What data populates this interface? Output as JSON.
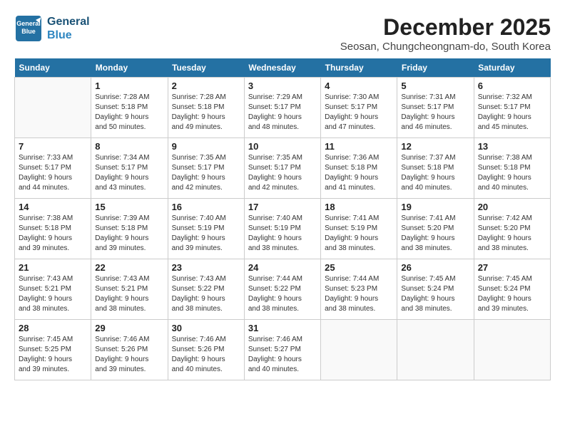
{
  "logo": {
    "line1": "General",
    "line2": "Blue"
  },
  "title": "December 2025",
  "location": "Seosan, Chungcheongnam-do, South Korea",
  "weekdays": [
    "Sunday",
    "Monday",
    "Tuesday",
    "Wednesday",
    "Thursday",
    "Friday",
    "Saturday"
  ],
  "weeks": [
    [
      {
        "day": "",
        "info": ""
      },
      {
        "day": "1",
        "info": "Sunrise: 7:28 AM\nSunset: 5:18 PM\nDaylight: 9 hours\nand 50 minutes."
      },
      {
        "day": "2",
        "info": "Sunrise: 7:28 AM\nSunset: 5:18 PM\nDaylight: 9 hours\nand 49 minutes."
      },
      {
        "day": "3",
        "info": "Sunrise: 7:29 AM\nSunset: 5:17 PM\nDaylight: 9 hours\nand 48 minutes."
      },
      {
        "day": "4",
        "info": "Sunrise: 7:30 AM\nSunset: 5:17 PM\nDaylight: 9 hours\nand 47 minutes."
      },
      {
        "day": "5",
        "info": "Sunrise: 7:31 AM\nSunset: 5:17 PM\nDaylight: 9 hours\nand 46 minutes."
      },
      {
        "day": "6",
        "info": "Sunrise: 7:32 AM\nSunset: 5:17 PM\nDaylight: 9 hours\nand 45 minutes."
      }
    ],
    [
      {
        "day": "7",
        "info": "Sunrise: 7:33 AM\nSunset: 5:17 PM\nDaylight: 9 hours\nand 44 minutes."
      },
      {
        "day": "8",
        "info": "Sunrise: 7:34 AM\nSunset: 5:17 PM\nDaylight: 9 hours\nand 43 minutes."
      },
      {
        "day": "9",
        "info": "Sunrise: 7:35 AM\nSunset: 5:17 PM\nDaylight: 9 hours\nand 42 minutes."
      },
      {
        "day": "10",
        "info": "Sunrise: 7:35 AM\nSunset: 5:17 PM\nDaylight: 9 hours\nand 42 minutes."
      },
      {
        "day": "11",
        "info": "Sunrise: 7:36 AM\nSunset: 5:18 PM\nDaylight: 9 hours\nand 41 minutes."
      },
      {
        "day": "12",
        "info": "Sunrise: 7:37 AM\nSunset: 5:18 PM\nDaylight: 9 hours\nand 40 minutes."
      },
      {
        "day": "13",
        "info": "Sunrise: 7:38 AM\nSunset: 5:18 PM\nDaylight: 9 hours\nand 40 minutes."
      }
    ],
    [
      {
        "day": "14",
        "info": "Sunrise: 7:38 AM\nSunset: 5:18 PM\nDaylight: 9 hours\nand 39 minutes."
      },
      {
        "day": "15",
        "info": "Sunrise: 7:39 AM\nSunset: 5:18 PM\nDaylight: 9 hours\nand 39 minutes."
      },
      {
        "day": "16",
        "info": "Sunrise: 7:40 AM\nSunset: 5:19 PM\nDaylight: 9 hours\nand 39 minutes."
      },
      {
        "day": "17",
        "info": "Sunrise: 7:40 AM\nSunset: 5:19 PM\nDaylight: 9 hours\nand 38 minutes."
      },
      {
        "day": "18",
        "info": "Sunrise: 7:41 AM\nSunset: 5:19 PM\nDaylight: 9 hours\nand 38 minutes."
      },
      {
        "day": "19",
        "info": "Sunrise: 7:41 AM\nSunset: 5:20 PM\nDaylight: 9 hours\nand 38 minutes."
      },
      {
        "day": "20",
        "info": "Sunrise: 7:42 AM\nSunset: 5:20 PM\nDaylight: 9 hours\nand 38 minutes."
      }
    ],
    [
      {
        "day": "21",
        "info": "Sunrise: 7:43 AM\nSunset: 5:21 PM\nDaylight: 9 hours\nand 38 minutes."
      },
      {
        "day": "22",
        "info": "Sunrise: 7:43 AM\nSunset: 5:21 PM\nDaylight: 9 hours\nand 38 minutes."
      },
      {
        "day": "23",
        "info": "Sunrise: 7:43 AM\nSunset: 5:22 PM\nDaylight: 9 hours\nand 38 minutes."
      },
      {
        "day": "24",
        "info": "Sunrise: 7:44 AM\nSunset: 5:22 PM\nDaylight: 9 hours\nand 38 minutes."
      },
      {
        "day": "25",
        "info": "Sunrise: 7:44 AM\nSunset: 5:23 PM\nDaylight: 9 hours\nand 38 minutes."
      },
      {
        "day": "26",
        "info": "Sunrise: 7:45 AM\nSunset: 5:24 PM\nDaylight: 9 hours\nand 38 minutes."
      },
      {
        "day": "27",
        "info": "Sunrise: 7:45 AM\nSunset: 5:24 PM\nDaylight: 9 hours\nand 39 minutes."
      }
    ],
    [
      {
        "day": "28",
        "info": "Sunrise: 7:45 AM\nSunset: 5:25 PM\nDaylight: 9 hours\nand 39 minutes."
      },
      {
        "day": "29",
        "info": "Sunrise: 7:46 AM\nSunset: 5:26 PM\nDaylight: 9 hours\nand 39 minutes."
      },
      {
        "day": "30",
        "info": "Sunrise: 7:46 AM\nSunset: 5:26 PM\nDaylight: 9 hours\nand 40 minutes."
      },
      {
        "day": "31",
        "info": "Sunrise: 7:46 AM\nSunset: 5:27 PM\nDaylight: 9 hours\nand 40 minutes."
      },
      {
        "day": "",
        "info": ""
      },
      {
        "day": "",
        "info": ""
      },
      {
        "day": "",
        "info": ""
      }
    ]
  ]
}
